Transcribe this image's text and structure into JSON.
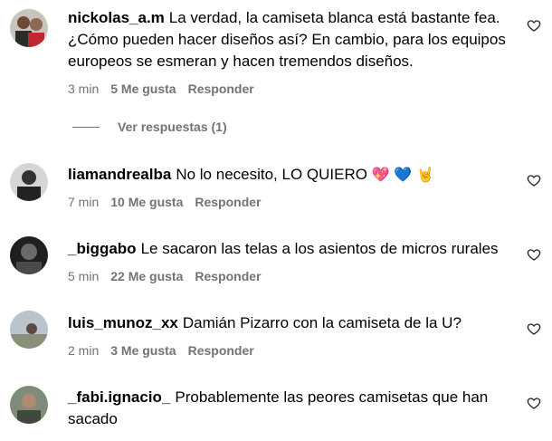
{
  "comments": [
    {
      "username": "nickolas_a.m",
      "text": "La verdad, la camiseta blanca está bastante fea. ¿Cómo pueden hacer diseños así? En cambio, para los equipos europeos se esmeran y hacen tremendos diseños.",
      "time": "3 min",
      "likes": "5 Me gusta",
      "reply": "Responder",
      "avatar_color": "#7a5a4a"
    },
    {
      "username": "liamandrealba",
      "text": "No lo necesito, LO QUIERO",
      "emojis": [
        "💖",
        "💙",
        "🤘"
      ],
      "time": "7 min",
      "likes": "10 Me gusta",
      "reply": "Responder",
      "avatar_color": "#444444"
    },
    {
      "username": "_biggabo",
      "text": "Le sacaron las telas a los asientos de micros rurales",
      "time": "5 min",
      "likes": "22 Me gusta",
      "reply": "Responder",
      "avatar_color": "#3a3a3a"
    },
    {
      "username": "luis_munoz_xx",
      "text": "Damián Pizarro con la camiseta de la U?",
      "time": "2 min",
      "likes": "3 Me gusta",
      "reply": "Responder",
      "avatar_color": "#9aa3a8"
    },
    {
      "username": "_fabi.ignacio_",
      "text": "Probablemente las peores camisetas que han sacado",
      "time": "",
      "likes": "",
      "reply": "",
      "avatar_color": "#5e6b5a"
    }
  ],
  "replies_toggle": "Ver respuestas (1)",
  "colors": {
    "meta": "#737373",
    "heart_outline": "#262626"
  }
}
